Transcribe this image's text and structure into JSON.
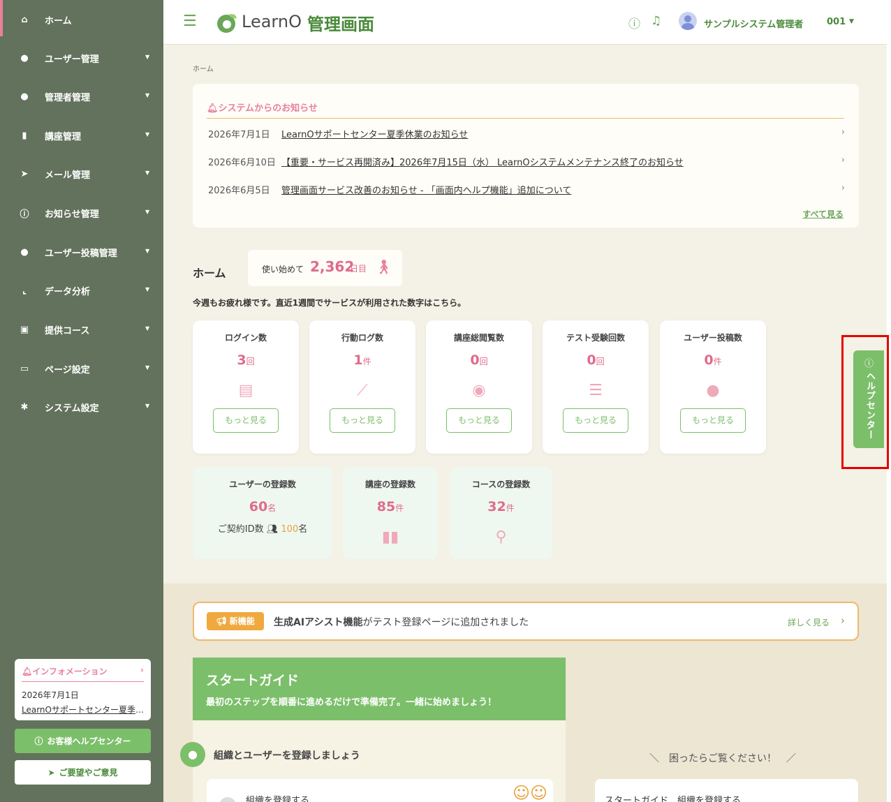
{
  "sidebar": {
    "items": [
      {
        "label": "ホーム",
        "icon": "home-icon",
        "glyph": "⌂"
      },
      {
        "label": "ユーザー管理",
        "icon": "user-icon",
        "glyph": "●"
      },
      {
        "label": "管理者管理",
        "icon": "admin-icon",
        "glyph": "●"
      },
      {
        "label": "講座管理",
        "icon": "book-icon",
        "glyph": "▮"
      },
      {
        "label": "メール管理",
        "icon": "send-icon",
        "glyph": "➤"
      },
      {
        "label": "お知らせ管理",
        "icon": "info-icon",
        "glyph": "ⓘ"
      },
      {
        "label": "ユーザー投稿管理",
        "icon": "comments-icon",
        "glyph": "●"
      },
      {
        "label": "データ分析",
        "icon": "chart-icon",
        "glyph": "⌞"
      },
      {
        "label": "提供コース",
        "icon": "gift-icon",
        "glyph": "▣"
      },
      {
        "label": "ページ設定",
        "icon": "monitor-icon",
        "glyph": "▭"
      },
      {
        "label": "システム設定",
        "icon": "gear-icon",
        "glyph": "✱"
      }
    ],
    "info_card": {
      "title": "インフォメーション",
      "date": "2026年7月1日",
      "text": "LearnOサポートセンター夏季休業のお知らせ"
    },
    "help_button": "お客様ヘルプセンター",
    "feedback_button": "ご要望やご意見"
  },
  "header": {
    "logo_text": "LearnO",
    "logo_sub": "管理画面",
    "user_name": "サンプルシステム管理者",
    "user_number": "001"
  },
  "breadcrumb": "ホーム",
  "notices": {
    "title": "システムからのお知らせ",
    "items": [
      {
        "date": "2026年7月1日",
        "text": "LearnOサポートセンター夏季休業のお知らせ"
      },
      {
        "date": "2026年6月10日",
        "text": "【重要・サービス再開済み】2026年7月15日（水） LearnOシステムメンテナンス終了のお知らせ"
      },
      {
        "date": "2026年6月5日",
        "text": "管理画面サービス改善のお知らせ - 「画面内ヘルプ機能」追加について"
      }
    ],
    "see_all": "すべて見る"
  },
  "home": {
    "title": "ホーム",
    "days_label": "使い始めて",
    "days_value": "2,362",
    "days_unit": "日目",
    "week_note": "今週もお疲れ様です。直近1週間でサービスが利用された数字はこちら。"
  },
  "stats": [
    {
      "label": "ログイン数",
      "value": "3",
      "unit": "回",
      "icon": "id-card-icon",
      "glyph": "▤",
      "button": "もっと見る"
    },
    {
      "label": "行動ログ数",
      "value": "1",
      "unit": "件",
      "icon": "line-chart-icon",
      "glyph": "⟋",
      "button": "もっと見る"
    },
    {
      "label": "講座総閲覧数",
      "value": "0",
      "unit": "回",
      "icon": "eye-icon",
      "glyph": "◉",
      "button": "もっと見る"
    },
    {
      "label": "テスト受験回数",
      "value": "0",
      "unit": "回",
      "icon": "checklist-icon",
      "glyph": "☰",
      "button": "もっと見る"
    },
    {
      "label": "ユーザー投稿数",
      "value": "0",
      "unit": "件",
      "icon": "comments-icon",
      "glyph": "●",
      "button": "もっと見る"
    }
  ],
  "registrations": [
    {
      "label": "ユーザーの登録数",
      "value": "60",
      "unit": "名",
      "sub_label": "ご契約ID数",
      "sub_value": "100",
      "sub_unit": "名"
    },
    {
      "label": "講座の登録数",
      "value": "85",
      "unit": "件",
      "icon": "book-open-icon",
      "glyph": "▮▮"
    },
    {
      "label": "コースの登録数",
      "value": "32",
      "unit": "件",
      "icon": "route-icon",
      "glyph": "⚲"
    }
  ],
  "new_feature": {
    "badge": "新機能",
    "bold_text": "生成AIアシスト機能",
    "text": "がテスト登録ページに追加されました",
    "link": "詳しく見る"
  },
  "start_guide": {
    "title": "スタートガイド",
    "subtitle": "最初のステップを順番に進めるだけで準備完了。一緒に始めましょう！",
    "step_label": "組織とユーザーを登録しましょう",
    "card_text": "組織を登録する"
  },
  "trouble": {
    "title": "困ったらご覧ください！",
    "card_text": "スタートガイド　組織を登録する"
  },
  "help_tab": "ヘルプセンター",
  "colors": {
    "sidebar": "#63725c",
    "accent_green": "#7cbf6a",
    "pink": "#e06b8b",
    "orange": "#f0a93e",
    "highlight": "#e60000"
  }
}
